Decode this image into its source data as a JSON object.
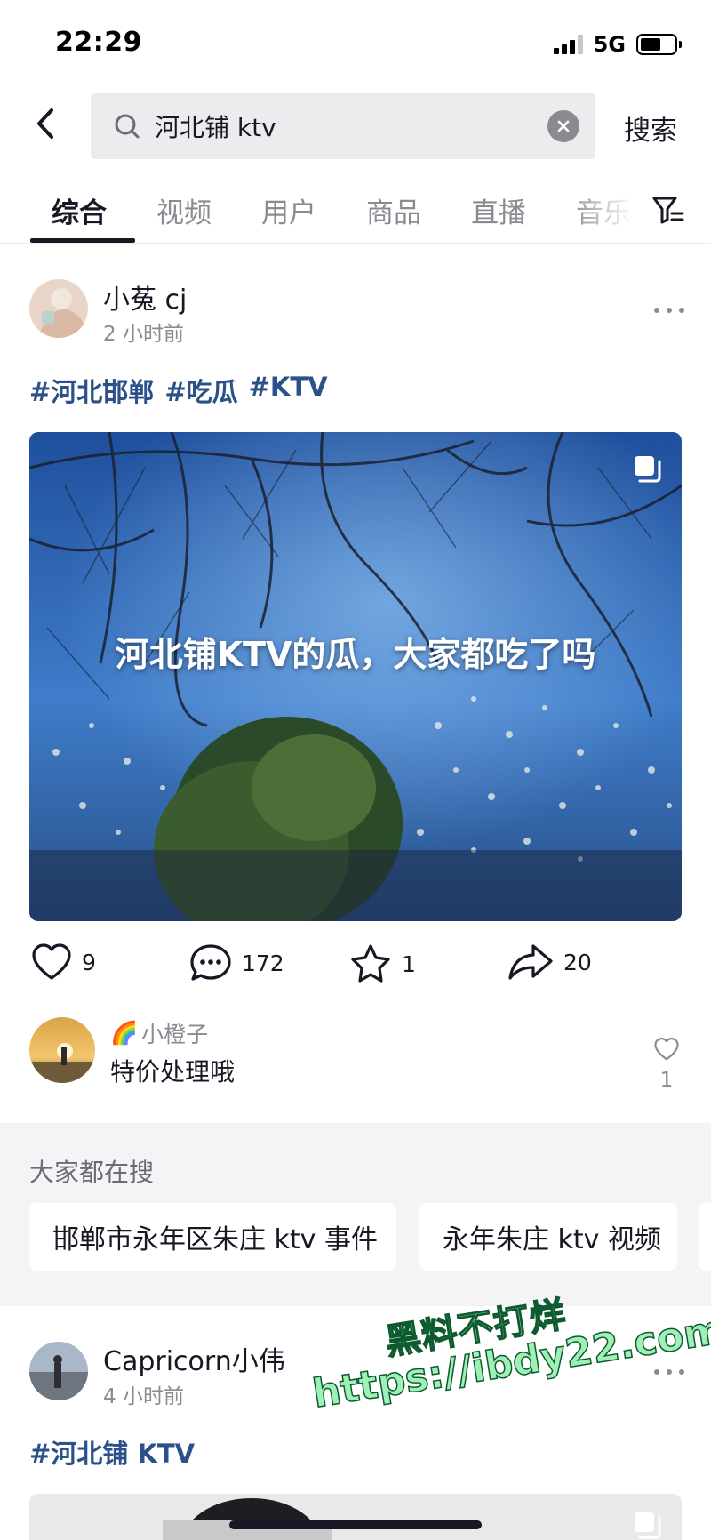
{
  "status": {
    "time": "22:29",
    "network": "5G"
  },
  "search": {
    "query": "河北铺 ktv",
    "submit_label": "搜索"
  },
  "tabs": [
    {
      "label": "综合"
    },
    {
      "label": "视频"
    },
    {
      "label": "用户"
    },
    {
      "label": "商品"
    },
    {
      "label": "直播"
    },
    {
      "label": "音乐"
    }
  ],
  "active_tab": "综合",
  "post1": {
    "author": "小菟 cj",
    "time": "2 小时前",
    "tags": [
      "#河北邯郸",
      "#吃瓜",
      "#KTV"
    ],
    "cover_title": "河北铺KTV的瓜，大家都吃了吗",
    "likes": "9",
    "comments": "172",
    "favorites": "1",
    "shares": "20"
  },
  "comment": {
    "author_emoji": "🌈",
    "author": "小橙子",
    "text": "特价处理哦",
    "likes": "1"
  },
  "suggestions": {
    "title": "大家都在搜",
    "items": [
      "邯郸市永年区朱庄 ktv 事件",
      "永年朱庄 ktv 视频"
    ]
  },
  "post2": {
    "author": "Capricorn小伟",
    "time": "4 小时前",
    "tags": [
      "#河北铺 KTV"
    ]
  },
  "watermark": {
    "line1": "黑料不打烊",
    "line2": "https://ibdy22.com"
  },
  "colors": {
    "tag": "#2b5288",
    "text": "#161823",
    "muted": "#8a8b91",
    "section_bg": "#f4f4f6"
  }
}
